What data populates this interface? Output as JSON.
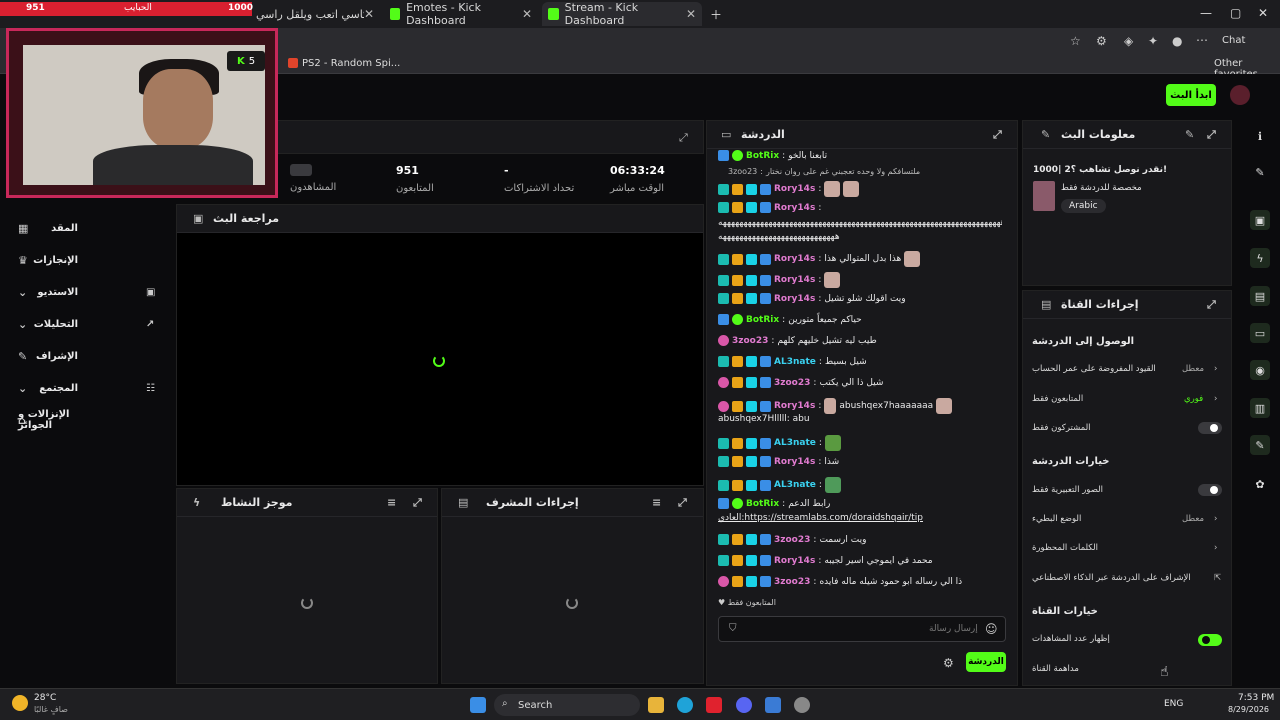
{
  "browser": {
    "tabs": [
      {
        "label": "اضرب ازيد يكاسي اتعب ويلقل راسي"
      },
      {
        "label": "Emotes - Kick Dashboard"
      },
      {
        "label": "Stream - Kick Dashboard"
      }
    ],
    "bookmark": "PS2 - Random Spi...",
    "other_favorites": "Other favorites",
    "chat_label": "Chat"
  },
  "overlay": {
    "viewer_badge_left": "951",
    "viewer_badge_right": "1000",
    "viewer_badge_title": "الحبايب",
    "kick_count": "5"
  },
  "header": {
    "go_live": "ابدأ البث"
  },
  "stats": [
    {
      "value": "",
      "label": "المشاهدون"
    },
    {
      "value": "951",
      "label": "المتابعون"
    },
    {
      "value": "-",
      "label": "تحداد الاشتراكات"
    },
    {
      "value": "06:33:24",
      "label": "الوقت مباشر"
    }
  ],
  "sidebar": {
    "items": [
      {
        "label": "المقد"
      },
      {
        "label": "الإنجازات"
      },
      {
        "label": "الاستديو"
      },
      {
        "label": "التحليلات"
      },
      {
        "label": "الإشراف"
      },
      {
        "label": "المجتمع"
      },
      {
        "label": "الإنزالات و الجوائز"
      }
    ]
  },
  "panels": {
    "stream_review": "مراجعة البث",
    "activity": "موجز النشاط",
    "mod_actions": "إجراءات المشرف",
    "chat": "الدردشة",
    "stream_info": "معلومات البث",
    "channel_actions": "إجراءات القناة"
  },
  "chat": {
    "messages": [
      {
        "user": "BotRix",
        "text": "تابعنا بالخو"
      },
      {
        "user": "3zoo23",
        "text": "ملتسافكم ولا وحده تعجبني غم على روان نختار"
      },
      {
        "user": "Rory14s",
        "text": ""
      },
      {
        "user": "Rory14s",
        "text": ""
      },
      {
        "user": "",
        "text": "ههههههههههههههههههههههههههههههههههههههههههههههههههههههههههههههههههههه"
      },
      {
        "user": "",
        "text": "ههههههههههههههههههههههههههههه"
      },
      {
        "user": "Rory14s",
        "text": "هذا بدل المتوالي هذا"
      },
      {
        "user": "Rory14s",
        "text": ""
      },
      {
        "user": "Rory14s",
        "text": "ويت اقولك شلو تشيل"
      },
      {
        "user": "BotRix",
        "text": "حياكم جميعاً متورين"
      },
      {
        "user": "3zoo23",
        "text": "طيب ليه تشيل خليهم كلهم"
      },
      {
        "user": "AL3nate",
        "text": "شيل بسيط"
      },
      {
        "user": "3zoo23",
        "text": "شيل ذا الي يكتب"
      },
      {
        "user": "Rory14s",
        "text": "abushqex7haaaaaaa"
      },
      {
        "user": "",
        "text": "abushqex7Hlllll: abu"
      },
      {
        "user": "AL3nate",
        "text": ""
      },
      {
        "user": "Rory14s",
        "text": "شذا"
      },
      {
        "user": "AL3nate",
        "text": ""
      },
      {
        "user": "BotRix",
        "text": "رابط الدعم"
      },
      {
        "user": "",
        "text": "العادي:https://streamlabs.com/doraidshqair/tip"
      },
      {
        "user": "3zoo23",
        "text": "ويت ارسمت"
      },
      {
        "user": "Rory14s",
        "text": "محمد في ايموجي اسير لجيبه"
      },
      {
        "user": "3zoo23",
        "text": "ذا الي رساله ابو حمود شيله ماله فايده"
      }
    ],
    "followers_only": "المتابعون فقط",
    "input_placeholder": "إرسال رسالة",
    "send_button": "الدردشة"
  },
  "stream_info": {
    "title": "نقدر نوصل تشاهب ؟2 |1000!",
    "category": "مخصصة للدردشة فقط",
    "language": "Arabic"
  },
  "channel_actions": {
    "chat_access": "الوصول إلى الدردشة",
    "rows": [
      {
        "label": "القيود المفروضة على عمر الحساب",
        "value": "معطل"
      },
      {
        "label": "المتابعون فقط",
        "value": "فوري"
      },
      {
        "label": "المشتركون فقط",
        "value": ""
      }
    ],
    "chat_options": "خيارات الدردشة",
    "chat_rows": [
      {
        "label": "الصور التعبيرية فقط",
        "value": ""
      },
      {
        "label": "الوضع البطيء",
        "value": "معطل"
      },
      {
        "label": "الكلمات المحظورة",
        "value": ""
      },
      {
        "label": "الإشراف على الدردشة عبر الذكاء الاصطناعي",
        "value": ""
      }
    ],
    "channel_options": "خيارات القناة",
    "show_viewers": "إظهار عدد المشاهدات",
    "host_channel": "مداهمة القناة"
  },
  "taskbar": {
    "weather_temp": "28°C",
    "weather_desc": "صافٍ غالبًا",
    "search": "Search",
    "lang": "ENG",
    "time": "7:53 PM",
    "date": "8/29/2026"
  }
}
